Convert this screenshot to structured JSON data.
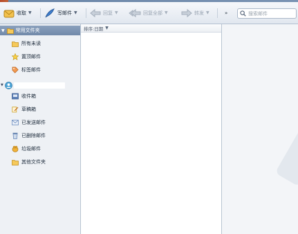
{
  "toolbar": {
    "receive_label": "收取",
    "compose_label": "写邮件",
    "reply_label": "回复",
    "reply_all_label": "回复全部",
    "forward_label": "转发",
    "more_label": "»"
  },
  "search": {
    "placeholder": "搜索邮件"
  },
  "sidebar": {
    "common_folders": {
      "header": "常用文件夹",
      "items": [
        {
          "label": "所有未读",
          "icon": "folder-icon"
        },
        {
          "label": "置顶邮件",
          "icon": "star-icon"
        },
        {
          "label": "标签邮件",
          "icon": "tag-icon"
        }
      ]
    },
    "account": {
      "name": "",
      "items": [
        {
          "label": "收件箱",
          "icon": "inbox-icon"
        },
        {
          "label": "草稿箱",
          "icon": "draft-icon"
        },
        {
          "label": "已发送邮件",
          "icon": "sent-icon"
        },
        {
          "label": "已删除邮件",
          "icon": "trash-icon"
        },
        {
          "label": "垃圾邮件",
          "icon": "spam-icon"
        },
        {
          "label": "其他文件夹",
          "icon": "folder-icon"
        }
      ]
    }
  },
  "list": {
    "sort_label": "排序:日期"
  }
}
